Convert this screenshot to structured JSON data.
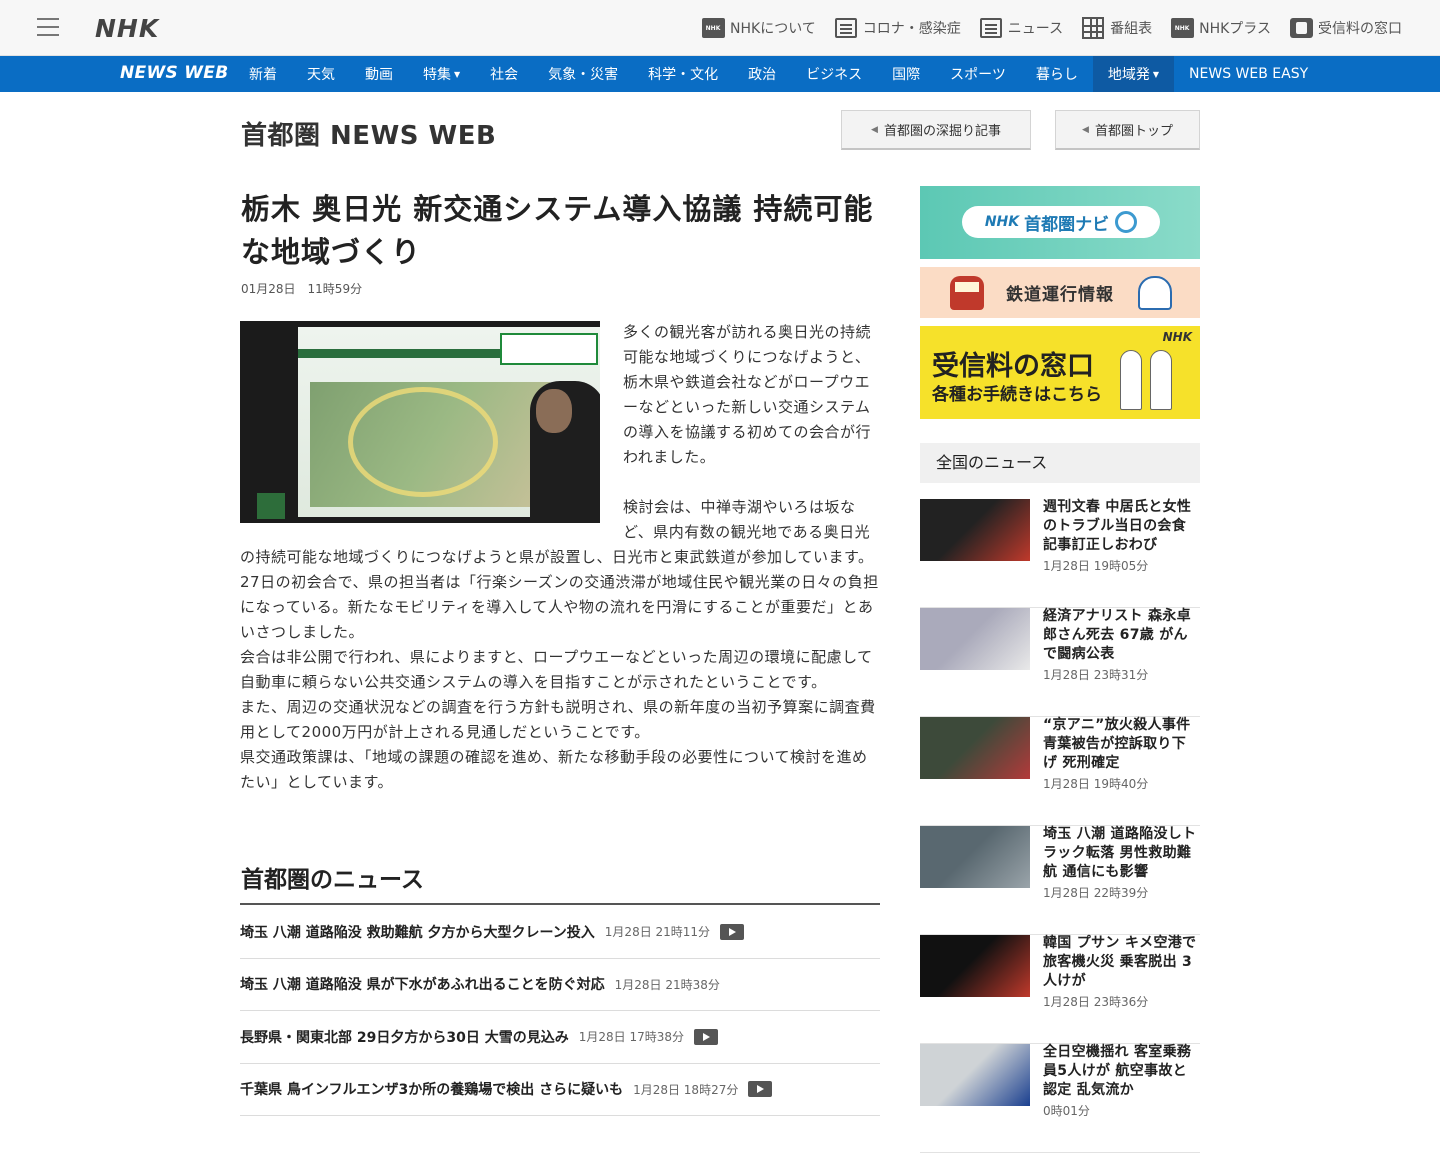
{
  "header": {
    "logo": "NHK",
    "links": [
      {
        "label": "NHKについて",
        "icon": "nhk-about-icon"
      },
      {
        "label": "コロナ・感染症",
        "icon": "corona-icon"
      },
      {
        "label": "ニュース",
        "icon": "news-icon"
      },
      {
        "label": "番組表",
        "icon": "program-guide-icon"
      },
      {
        "label": "NHKプラス",
        "icon": "nhk-plus-icon"
      },
      {
        "label": "受信料の窓口",
        "icon": "license-fee-icon"
      }
    ]
  },
  "nav": {
    "logo": "NEWS WEB",
    "items": [
      "新着",
      "天気",
      "動画",
      "特集",
      "社会",
      "気象・災害",
      "科学・文化",
      "政治",
      "ビジネス",
      "国際",
      "スポーツ",
      "暮らし",
      "地域発",
      "NEWS WEB EASY"
    ]
  },
  "page": {
    "title": "首都圏 NEWS WEB",
    "btn_deep": "首都圏の深掘り記事",
    "btn_top": "首都圏トップ"
  },
  "article": {
    "headline": "栃木 奥日光 新交通システム導入協議 持続可能な地域づくり",
    "date": "01月28日　11時59分",
    "paragraphs": [
      "多くの観光客が訪れる奥日光の持続可能な地域づくりにつなげようと、栃木県や鉄道会社などがロープウエーなどといった新しい交通システムの導入を協議する初めての会合が行われました。",
      "検討会は、中禅寺湖やいろは坂など、県内有数の観光地である奥日光の持続可能な地域づくりにつなげようと県が設置し、日光市と東武鉄道が参加しています。",
      "27日の初会合で、県の担当者は「行楽シーズンの交通渋滞が地域住民や観光業の日々の負担になっている。新たなモビリティを導入して人や物の流れを円滑にすることが重要だ」とあいさつしました。",
      "会合は非公開で行われ、県によりますと、ロープウエーなどといった周辺の環境に配慮して自動車に頼らない公共交通システムの導入を目指すことが示されたということです。",
      "また、周辺の交通状況などの調査を行う方針も説明され、県の新年度の当初予算案に調査費用として2000万円が計上される見通しだということです。",
      "県交通政策課は、「地域の課題の確認を進め、新たな移動手段の必要性について検討を進めたい」としています。"
    ]
  },
  "metro": {
    "title": "首都圏のニュース",
    "items": [
      {
        "title": "埼玉 八潮 道路陥没 救助難航 夕方から大型クレーン投入",
        "date": "1月28日 21時11分",
        "video": true
      },
      {
        "title": "埼玉 八潮 道路陥没 県が下水があふれ出ることを防ぐ対応",
        "date": "1月28日 21時38分",
        "video": false
      },
      {
        "title": "長野県・関東北部 29日夕方から30日 大雪の見込み",
        "date": "1月28日 17時38分",
        "video": true
      },
      {
        "title": "千葉県 鳥インフルエンザ3か所の養鶏場で検出 さらに疑いも",
        "date": "1月28日 18時27分",
        "video": true
      }
    ]
  },
  "sidebar": {
    "banner_navi": {
      "nhk": "NHK",
      "label": "首都圏ナビ"
    },
    "banner_train": "鉄道運行情報",
    "banner_fee": {
      "line1": "受信料の窓口",
      "line2": "各種お手続きはこちら",
      "nhk": "NHK"
    },
    "national_title": "全国のニュース",
    "items": [
      {
        "title": "週刊文春 中居氏と女性のトラブル当日の会食 記事訂正しおわび",
        "date": "1月28日 19時05分",
        "colors": [
          "#222",
          "#c0392b"
        ]
      },
      {
        "title": "経済アナリスト 森永卓郎さん死去 67歳 がんで闘病公表",
        "date": "1月28日 23時31分",
        "colors": [
          "#aab",
          "#e9e9e9"
        ]
      },
      {
        "title": "“京アニ”放火殺人事件 青葉被告が控訴取り下げ 死刑確定",
        "date": "1月28日 19時40分",
        "colors": [
          "#3d4a3a",
          "#b33a3a"
        ]
      },
      {
        "title": "埼玉 八潮 道路陥没しトラック転落 男性救助難航 通信にも影響",
        "date": "1月28日 22時39分",
        "colors": [
          "#596870",
          "#9aa4aa"
        ]
      },
      {
        "title": "韓国 プサン キメ空港で旅客機火災 乗客脱出 3人けが",
        "date": "1月28日 23時36分",
        "colors": [
          "#111",
          "#c0392b"
        ]
      },
      {
        "title": "全日空機揺れ 客室乗務員5人けが 航空事故と認定 乱気流か",
        "date": "0時01分",
        "colors": [
          "#cfd3d6",
          "#1a3f8f"
        ]
      }
    ]
  }
}
